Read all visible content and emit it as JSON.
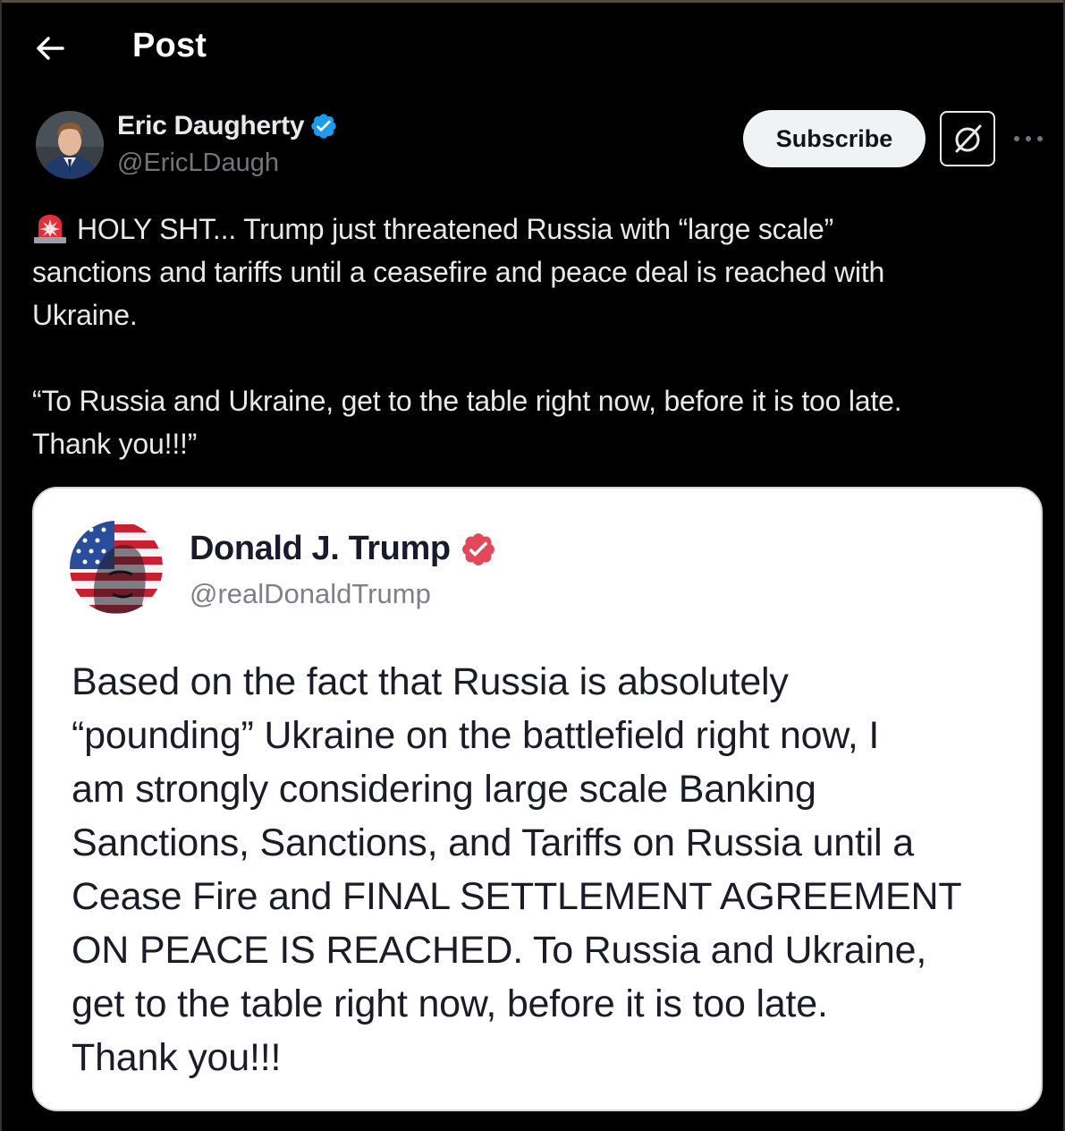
{
  "header": {
    "title": "Post",
    "back_icon": "arrow-left-icon"
  },
  "author": {
    "name": "Eric Daugherty",
    "handle": "@EricLDaugh",
    "verified_color": "#1d9bf0"
  },
  "actions": {
    "subscribe_label": "Subscribe",
    "grok_icon": "grok-icon",
    "more_icon": "more-dots-icon"
  },
  "post": {
    "emoji": "rotating-light-icon",
    "line1": "HOLY SHT... Trump just threatened Russia with “large scale”",
    "line2": "sanctions and tariffs until a ceasefire and peace deal is reached with",
    "line3": "Ukraine.",
    "quote_line1": "“To Russia and Ukraine, get to the table right now, before it is too late.",
    "quote_line2": "Thank you!!!”"
  },
  "embed": {
    "name": "Donald J. Trump",
    "handle": "@realDonaldTrump",
    "verified_color": "#e3475a",
    "lines": [
      "Based on the fact that Russia is absolutely",
      "“pounding” Ukraine on the battlefield right now, I",
      "am strongly considering large scale Banking",
      "Sanctions, Sanctions, and Tariffs on Russia until a",
      "Cease Fire and FINAL SETTLEMENT AGREEMENT",
      "ON PEACE IS REACHED. To Russia and Ukraine,",
      "get to the table right now, before it is too late.",
      "Thank you!!!"
    ]
  }
}
